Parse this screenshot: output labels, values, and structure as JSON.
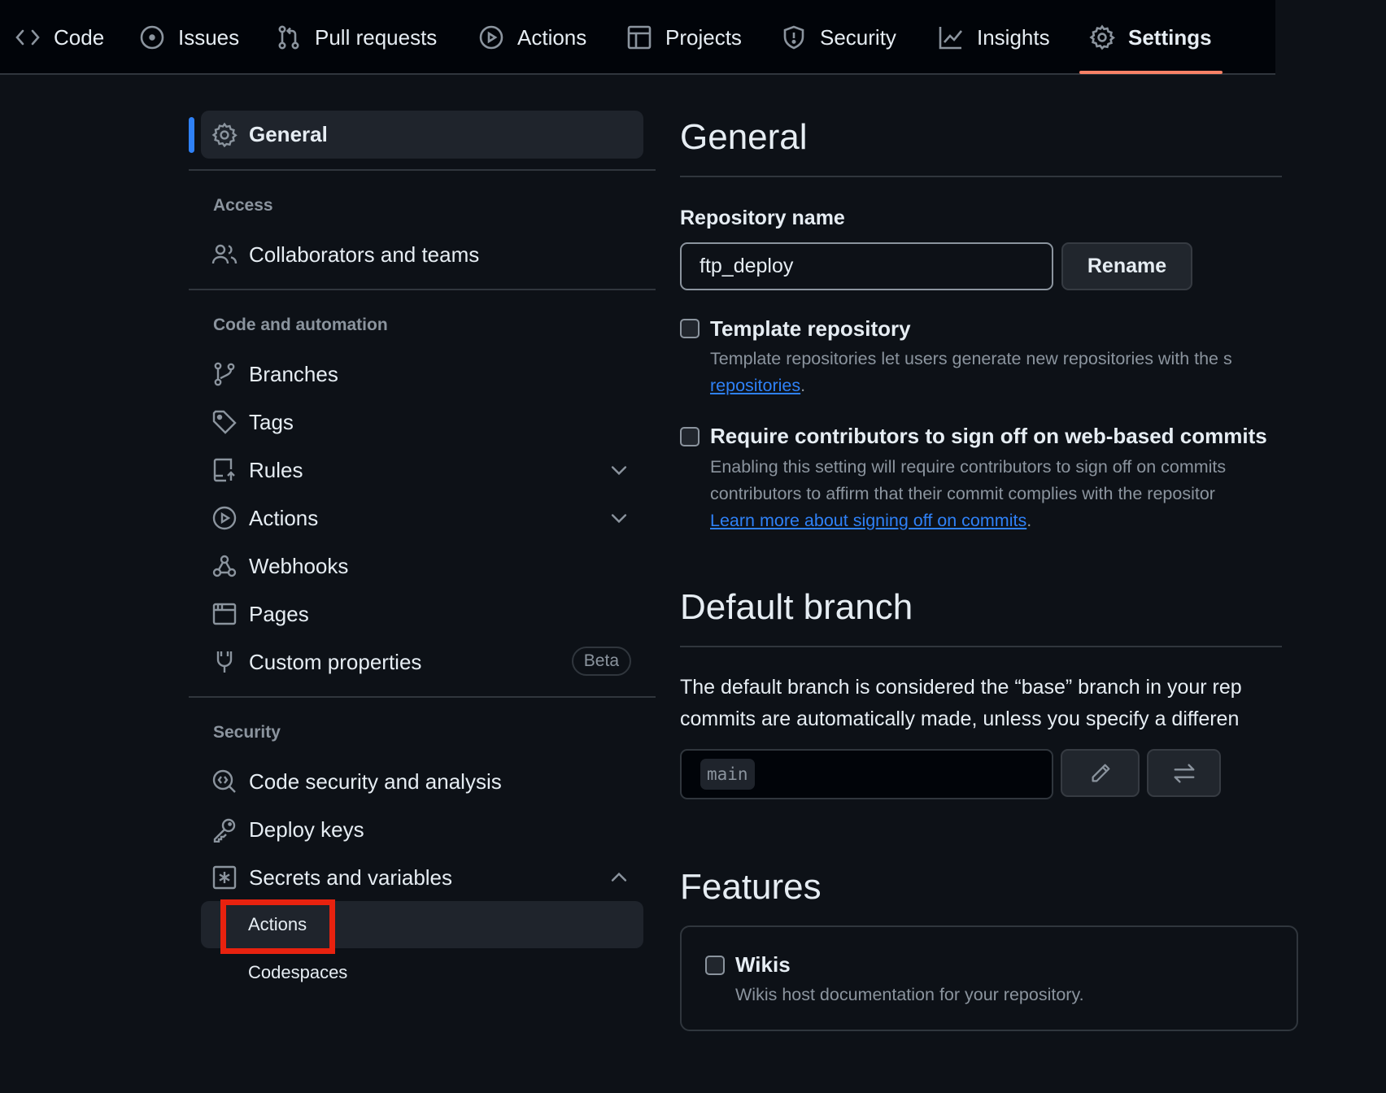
{
  "nav": {
    "tabs": [
      {
        "label": "Code",
        "icon": "code-icon"
      },
      {
        "label": "Issues",
        "icon": "issue-opened-icon"
      },
      {
        "label": "Pull requests",
        "icon": "git-pull-request-icon"
      },
      {
        "label": "Actions",
        "icon": "play-icon"
      },
      {
        "label": "Projects",
        "icon": "table-icon"
      },
      {
        "label": "Security",
        "icon": "shield-icon"
      },
      {
        "label": "Insights",
        "icon": "graph-icon"
      },
      {
        "label": "Settings",
        "icon": "gear-icon",
        "active": true
      }
    ]
  },
  "sidebar": {
    "general": "General",
    "sections": {
      "access": {
        "heading": "Access",
        "items": [
          "Collaborators and teams"
        ]
      },
      "code": {
        "heading": "Code and automation",
        "items": [
          "Branches",
          "Tags",
          "Rules",
          "Actions",
          "Webhooks",
          "Pages",
          "Custom properties"
        ],
        "badge": "Beta"
      },
      "security": {
        "heading": "Security",
        "items": [
          "Code security and analysis",
          "Deploy keys",
          "Secrets and variables"
        ],
        "subitems": [
          "Actions",
          "Codespaces"
        ]
      }
    }
  },
  "main": {
    "title": "General",
    "repo_name_label": "Repository name",
    "repo_name_value": "ftp_deploy",
    "rename_button": "Rename",
    "template": {
      "title": "Template repository",
      "desc": "Template repositories let users generate new repositories with the s",
      "link": "repositories",
      "period": "."
    },
    "signoff": {
      "title": "Require contributors to sign off on web-based commits",
      "line1": "Enabling this setting will require contributors to sign off on commits",
      "line2": "contributors to affirm that their commit complies with the repositor",
      "link": "Learn more about signing off on commits",
      "period": "."
    },
    "default_branch": {
      "title": "Default branch",
      "line1": "The default branch is considered the “base” branch in your rep",
      "line2": "commits are automatically made, unless you specify a differen",
      "branch": "main"
    },
    "features": {
      "title": "Features",
      "wikis_title": "Wikis",
      "wikis_desc": "Wikis host documentation for your repository."
    }
  },
  "colors": {
    "background": "#0d1117",
    "accent_underline": "#f78166",
    "active_bar": "#2f81f7",
    "highlight_box": "#e8220f",
    "link": "#2f81f7"
  }
}
